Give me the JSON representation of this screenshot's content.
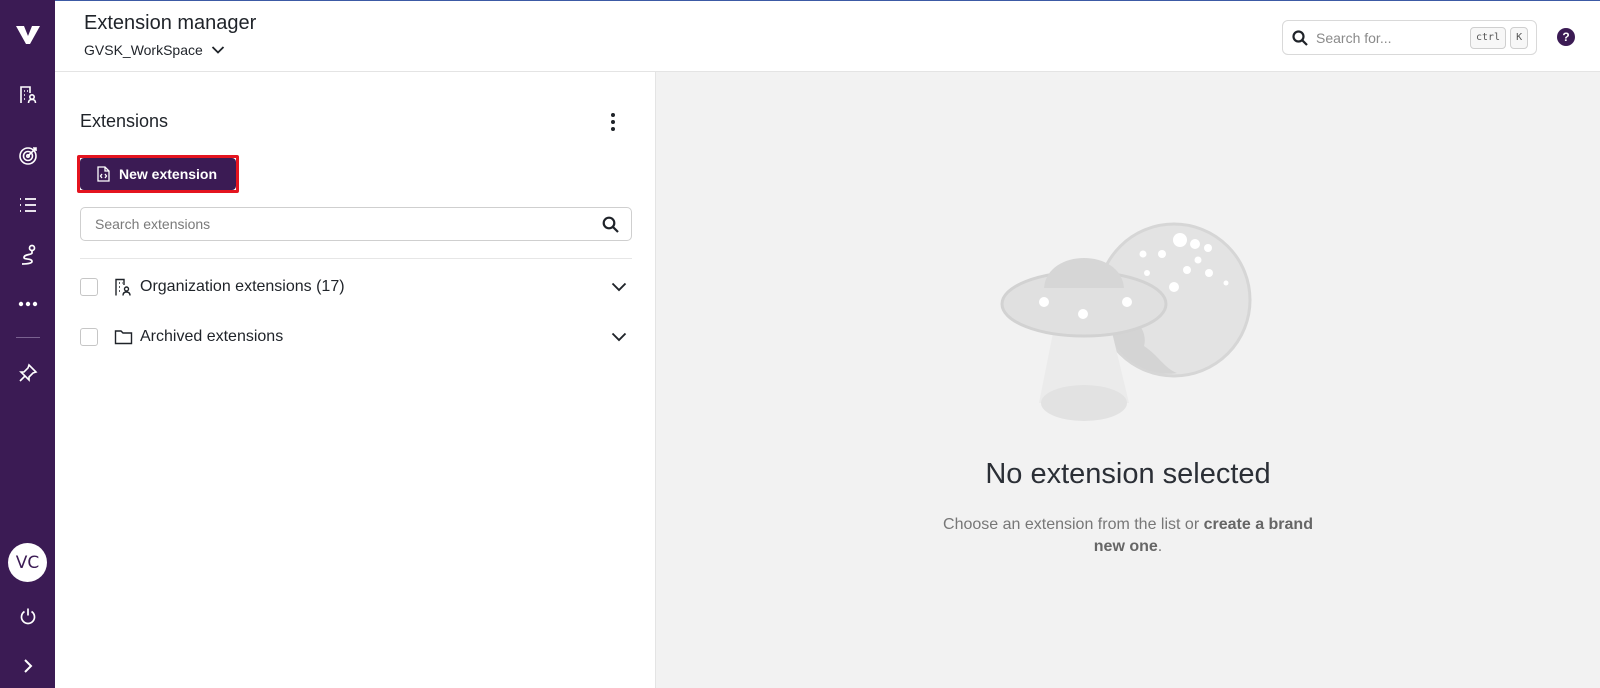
{
  "rail": {
    "logo_icon": "v-logo-icon",
    "items": [
      {
        "name": "organization-icon"
      },
      {
        "name": "target-icon"
      },
      {
        "name": "list-icon"
      },
      {
        "name": "route-icon"
      },
      {
        "name": "more-icon"
      },
      {
        "name": "pin-icon"
      }
    ],
    "avatar_initials": "VC",
    "power_icon": "power-icon",
    "expand_icon": "chevron-right-icon"
  },
  "header": {
    "title": "Extension manager",
    "workspace": "GVSK_WorkSpace",
    "search_placeholder": "Search for...",
    "shortcut_key1": "ctrl",
    "shortcut_key2": "K",
    "help_label": "?"
  },
  "panel": {
    "title": "Extensions",
    "new_extension_label": "New extension",
    "search_placeholder": "Search extensions",
    "groups": [
      {
        "label": "Organization extensions (17)",
        "icon": "organization-icon"
      },
      {
        "label": "Archived extensions",
        "icon": "folder-icon"
      }
    ]
  },
  "empty_state": {
    "title": "No extension selected",
    "desc_prefix": "Choose an extension from the list or ",
    "desc_link": "create a brand new one",
    "desc_suffix": "."
  },
  "colors": {
    "rail_bg": "#3b1b54",
    "primary": "#3b1b54",
    "highlight": "#e4141f"
  }
}
